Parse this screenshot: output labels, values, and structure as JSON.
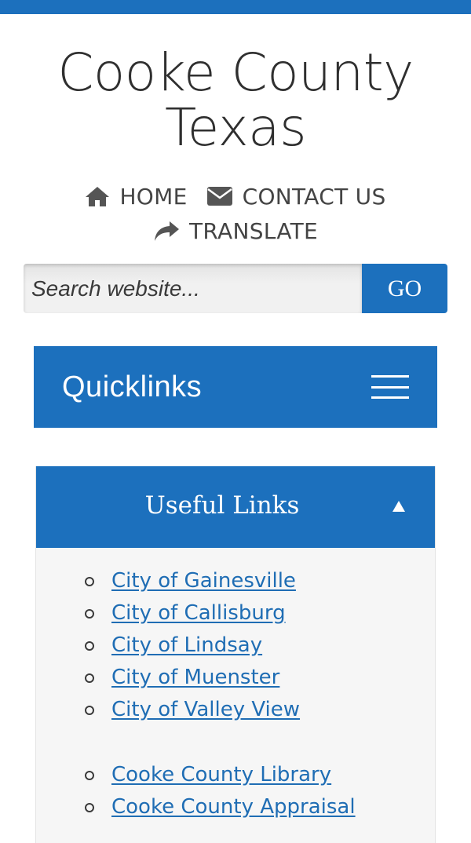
{
  "header": {
    "title_line1": "Cooke County",
    "title_line2": "Texas"
  },
  "nav": {
    "home": "HOME",
    "contact": "CONTACT US",
    "translate": "TRANSLATE"
  },
  "search": {
    "placeholder": "Search website...",
    "value": "",
    "button_label": "GO"
  },
  "quicklinks": {
    "label": "Quicklinks"
  },
  "useful_links": {
    "title": "Useful Links",
    "cities": [
      "City of Gainesville",
      "City of Callisburg",
      "City of Lindsay",
      "City of Muenster",
      "City of Valley View"
    ],
    "county": [
      "Cooke County Library",
      "Cooke County Appraisal"
    ]
  },
  "colors": {
    "accent": "#1c70bd",
    "link": "#1f6db4",
    "panel_bg": "#f6f6f6"
  },
  "icons": [
    "home-icon",
    "envelope-icon",
    "share-arrow-icon",
    "hamburger-menu-icon",
    "caret-up-icon"
  ]
}
